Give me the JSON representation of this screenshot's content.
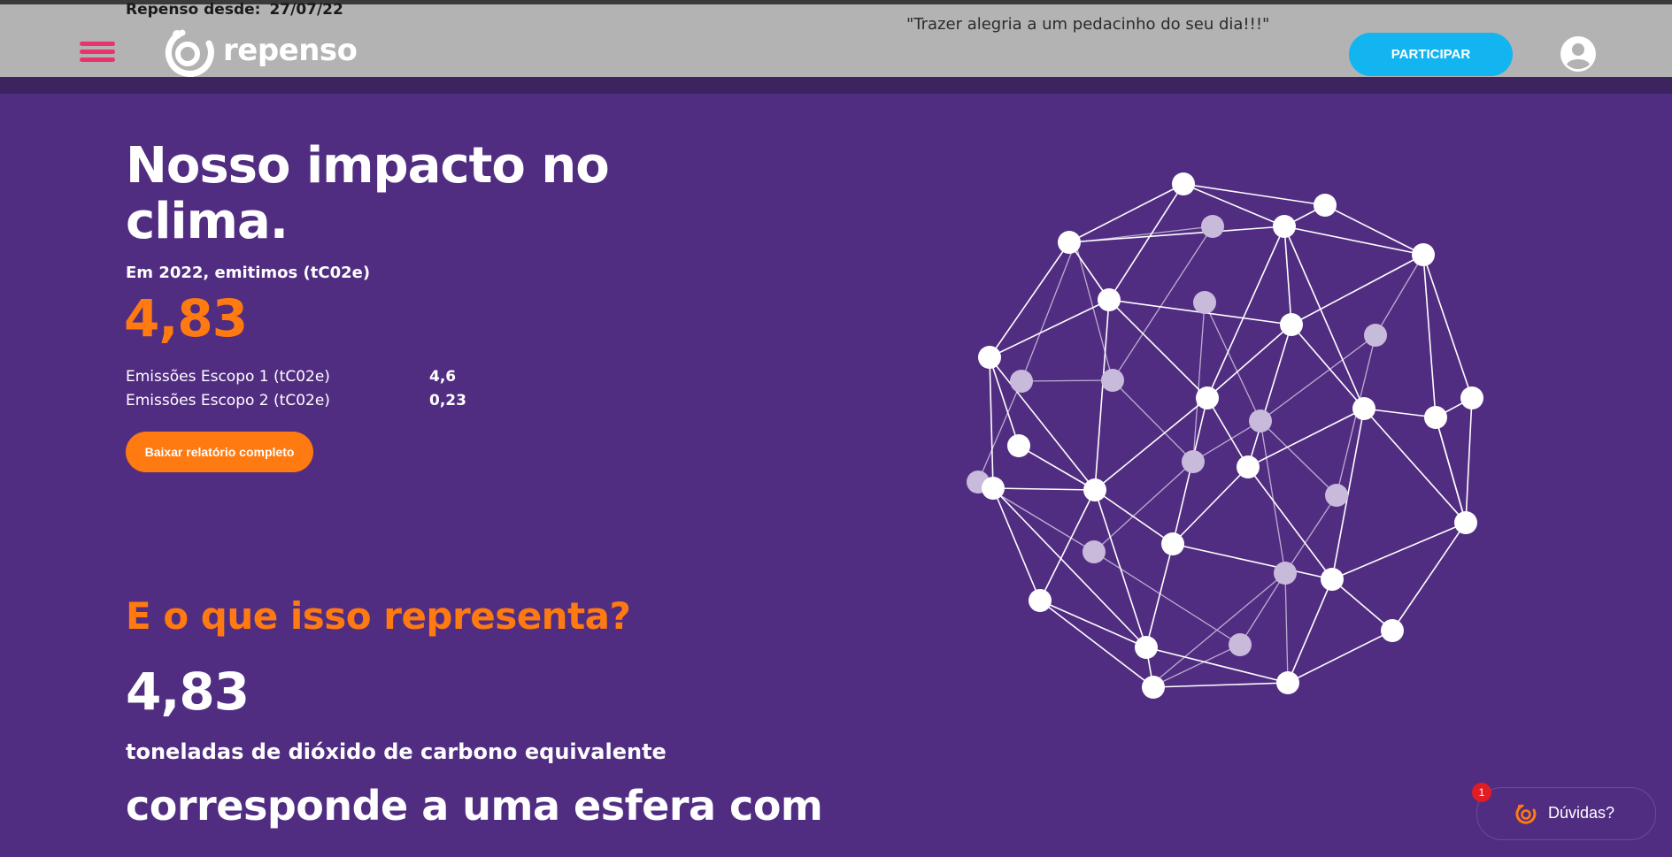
{
  "header": {
    "since_label": "Repenso desde:",
    "since_date": "27/07/22",
    "logo_text": "repenso",
    "tagline": "\"Trazer alegria a um pedacinho do seu dia!!!\"",
    "join_label": "PARTICIPAR"
  },
  "impact": {
    "title": "Nosso impacto no clima.",
    "emission_intro": "Em 2022, emitimos (tC02e)",
    "total": "4,83",
    "scopes": [
      {
        "label": "Emissões Escopo 1 (tC02e)",
        "value": "4,6"
      },
      {
        "label": "Emissões Escopo 2 (tC02e)",
        "value": "0,23"
      }
    ],
    "report_button": "Baixar relatório completo"
  },
  "represent": {
    "title": "E o que isso representa?",
    "total": "4,83",
    "unit": "toneladas de dióxido de carbono equivalente",
    "correspond": "corresponde a uma esfera com"
  },
  "help": {
    "label": "Dúvidas?",
    "badge": "1"
  },
  "colors": {
    "background": "#512d82",
    "accent_orange": "#ff7a10",
    "header_gray": "#b3b3b3",
    "join_blue": "#12b5f0",
    "menu_pink": "#e8336c"
  },
  "icons": [
    "menu-icon",
    "repenso-logo-icon",
    "user-avatar-icon",
    "chat-logo-icon",
    "sphere-network-illustration"
  ]
}
